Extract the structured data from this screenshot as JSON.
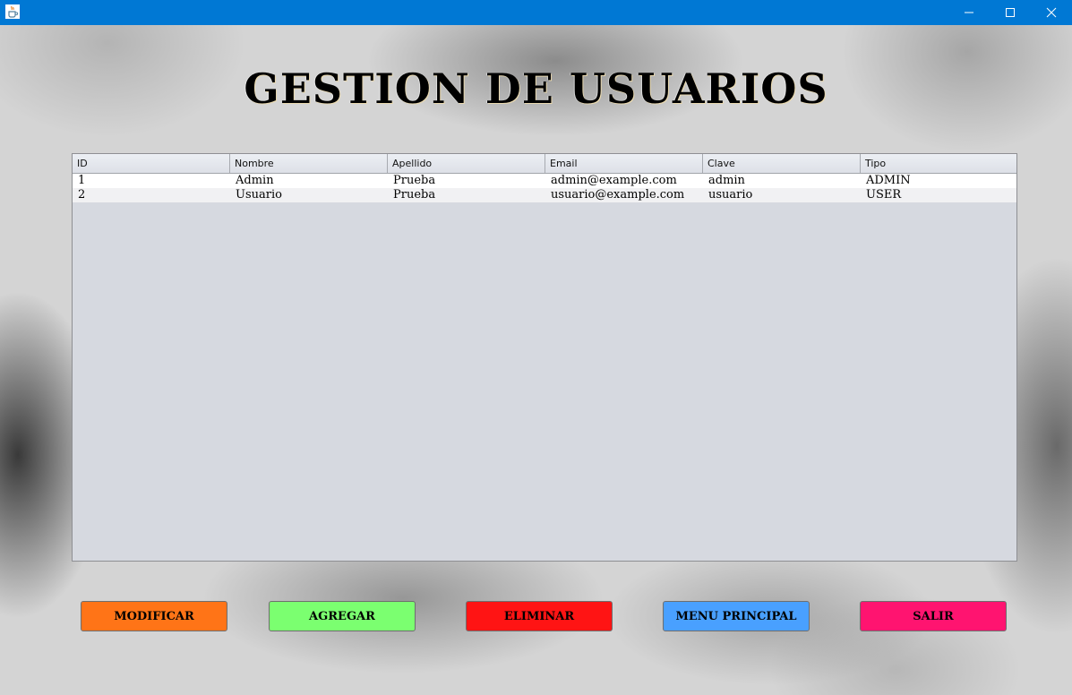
{
  "window": {
    "app_icon": "java-cup-icon",
    "controls": [
      "minimize-icon",
      "maximize-icon",
      "close-icon"
    ],
    "titlebar_color": "#0078d4"
  },
  "header": {
    "title": "GESTION DE USUARIOS"
  },
  "table": {
    "columns": [
      "ID",
      "Nombre",
      "Apellido",
      "Email",
      "Clave",
      "Tipo"
    ],
    "rows": [
      [
        "1",
        "Admin",
        "Prueba",
        "admin@example.com",
        "admin",
        "ADMIN"
      ],
      [
        "2",
        "Usuario",
        "Prueba",
        "usuario@example.com",
        "usuario",
        "USER"
      ]
    ]
  },
  "buttons": {
    "modificar": {
      "label": "MODIFICAR",
      "color": "#ff7417"
    },
    "agregar": {
      "label": "AGREGAR",
      "color": "#7bff70"
    },
    "eliminar": {
      "label": "ELIMINAR",
      "color": "#ff1414"
    },
    "menu_principal": {
      "label": "MENU PRINCIPAL",
      "color": "#49a0ff"
    },
    "salir": {
      "label": "SALIR",
      "color": "#ff1470"
    }
  }
}
